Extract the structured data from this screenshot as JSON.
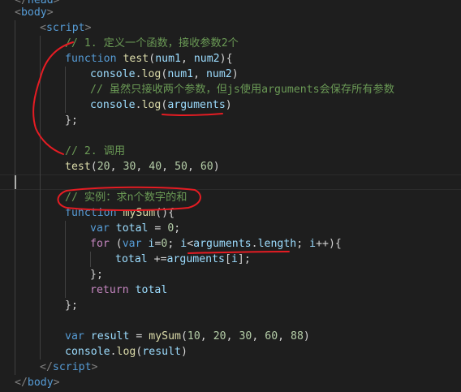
{
  "lines": [
    [
      {
        "c": "punct",
        "t": "</"
      },
      {
        "c": "tag",
        "t": "head"
      },
      {
        "c": "punct",
        "t": ">"
      }
    ],
    [
      {
        "c": "punct",
        "t": "<"
      },
      {
        "c": "tag",
        "t": "body"
      },
      {
        "c": "punct",
        "t": ">"
      }
    ],
    [
      {
        "c": "punct",
        "t": "<"
      },
      {
        "c": "tag",
        "t": "script"
      },
      {
        "c": "punct",
        "t": ">"
      }
    ],
    [
      {
        "c": "cmt",
        "t": "// 1. 定义一个函数，接收参数2个"
      }
    ],
    [
      {
        "c": "kw",
        "t": "function"
      },
      {
        "c": "plain",
        "t": " "
      },
      {
        "c": "fn",
        "t": "test"
      },
      {
        "c": "plain",
        "t": "("
      },
      {
        "c": "var",
        "t": "num1"
      },
      {
        "c": "plain",
        "t": ", "
      },
      {
        "c": "var",
        "t": "num2"
      },
      {
        "c": "plain",
        "t": "){"
      }
    ],
    [
      {
        "c": "var",
        "t": "console"
      },
      {
        "c": "plain",
        "t": "."
      },
      {
        "c": "fn",
        "t": "log"
      },
      {
        "c": "plain",
        "t": "("
      },
      {
        "c": "var",
        "t": "num1"
      },
      {
        "c": "plain",
        "t": ", "
      },
      {
        "c": "var",
        "t": "num2"
      },
      {
        "c": "plain",
        "t": ")"
      }
    ],
    [
      {
        "c": "cmt",
        "t": "// 虽然只接收两个参数，但js使用arguments会保存所有参数"
      }
    ],
    [
      {
        "c": "var",
        "t": "console"
      },
      {
        "c": "plain",
        "t": "."
      },
      {
        "c": "fn",
        "t": "log"
      },
      {
        "c": "plain",
        "t": "("
      },
      {
        "c": "var",
        "t": "arguments"
      },
      {
        "c": "plain",
        "t": ")"
      }
    ],
    [
      {
        "c": "plain",
        "t": "};"
      }
    ],
    [],
    [
      {
        "c": "cmt",
        "t": "// 2. 调用"
      }
    ],
    [
      {
        "c": "fn",
        "t": "test"
      },
      {
        "c": "plain",
        "t": "("
      },
      {
        "c": "num",
        "t": "20"
      },
      {
        "c": "plain",
        "t": ", "
      },
      {
        "c": "num",
        "t": "30"
      },
      {
        "c": "plain",
        "t": ", "
      },
      {
        "c": "num",
        "t": "40"
      },
      {
        "c": "plain",
        "t": ", "
      },
      {
        "c": "num",
        "t": "50"
      },
      {
        "c": "plain",
        "t": ", "
      },
      {
        "c": "num",
        "t": "60"
      },
      {
        "c": "plain",
        "t": ")"
      }
    ],
    [],
    [
      {
        "c": "cmt",
        "t": "// 实例：求n个数字的和"
      }
    ],
    [
      {
        "c": "kw",
        "t": "function"
      },
      {
        "c": "plain",
        "t": " "
      },
      {
        "c": "fn",
        "t": "mySum"
      },
      {
        "c": "plain",
        "t": "(){"
      }
    ],
    [
      {
        "c": "kw",
        "t": "var"
      },
      {
        "c": "plain",
        "t": " "
      },
      {
        "c": "var",
        "t": "total"
      },
      {
        "c": "plain",
        "t": " = "
      },
      {
        "c": "num",
        "t": "0"
      },
      {
        "c": "plain",
        "t": ";"
      }
    ],
    [
      {
        "c": "ctrl",
        "t": "for"
      },
      {
        "c": "plain",
        "t": " ("
      },
      {
        "c": "kw",
        "t": "var"
      },
      {
        "c": "plain",
        "t": " "
      },
      {
        "c": "var",
        "t": "i"
      },
      {
        "c": "plain",
        "t": "="
      },
      {
        "c": "num",
        "t": "0"
      },
      {
        "c": "plain",
        "t": "; "
      },
      {
        "c": "var",
        "t": "i"
      },
      {
        "c": "plain",
        "t": "<"
      },
      {
        "c": "var",
        "t": "arguments"
      },
      {
        "c": "plain",
        "t": "."
      },
      {
        "c": "var",
        "t": "length"
      },
      {
        "c": "plain",
        "t": "; "
      },
      {
        "c": "var",
        "t": "i"
      },
      {
        "c": "plain",
        "t": "++){"
      }
    ],
    [
      {
        "c": "var",
        "t": "total"
      },
      {
        "c": "plain",
        "t": " +="
      },
      {
        "c": "var",
        "t": "arguments"
      },
      {
        "c": "plain",
        "t": "["
      },
      {
        "c": "var",
        "t": "i"
      },
      {
        "c": "plain",
        "t": "];"
      }
    ],
    [
      {
        "c": "plain",
        "t": "};"
      }
    ],
    [
      {
        "c": "ctrl",
        "t": "return"
      },
      {
        "c": "plain",
        "t": " "
      },
      {
        "c": "var",
        "t": "total"
      }
    ],
    [
      {
        "c": "plain",
        "t": "};"
      }
    ],
    [],
    [
      {
        "c": "kw",
        "t": "var"
      },
      {
        "c": "plain",
        "t": " "
      },
      {
        "c": "var",
        "t": "result"
      },
      {
        "c": "plain",
        "t": " = "
      },
      {
        "c": "fn",
        "t": "mySum"
      },
      {
        "c": "plain",
        "t": "("
      },
      {
        "c": "num",
        "t": "10"
      },
      {
        "c": "plain",
        "t": ", "
      },
      {
        "c": "num",
        "t": "20"
      },
      {
        "c": "plain",
        "t": ", "
      },
      {
        "c": "num",
        "t": "30"
      },
      {
        "c": "plain",
        "t": ", "
      },
      {
        "c": "num",
        "t": "60"
      },
      {
        "c": "plain",
        "t": ", "
      },
      {
        "c": "num",
        "t": "88"
      },
      {
        "c": "plain",
        "t": ")"
      }
    ],
    [
      {
        "c": "var",
        "t": "console"
      },
      {
        "c": "plain",
        "t": "."
      },
      {
        "c": "fn",
        "t": "log"
      },
      {
        "c": "plain",
        "t": "("
      },
      {
        "c": "var",
        "t": "result"
      },
      {
        "c": "plain",
        "t": ")"
      }
    ],
    [
      {
        "c": "punct",
        "t": "</"
      },
      {
        "c": "tag",
        "t": "script"
      },
      {
        "c": "punct",
        "t": ">"
      }
    ],
    [
      {
        "c": "punct",
        "t": "</"
      },
      {
        "c": "tag",
        "t": "body"
      },
      {
        "c": "punct",
        "t": ">"
      }
    ]
  ],
  "colors": {
    "background": "#1e1e1e",
    "annotation": "#e51c23"
  }
}
